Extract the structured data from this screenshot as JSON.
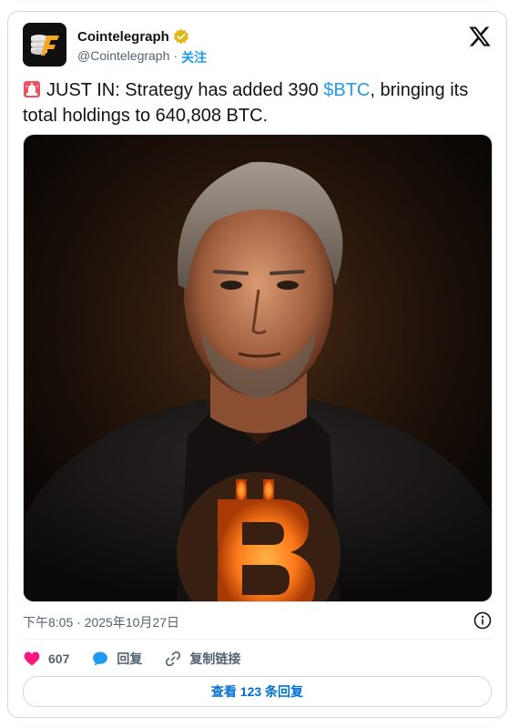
{
  "tweet": {
    "author_name": "Cointelegraph",
    "handle": "@Cointelegraph",
    "separator": "·",
    "follow_label": "关注",
    "text_prefix": "JUST IN: Strategy has added 390 ",
    "cashtag": "$BTC",
    "text_suffix": ", bringing its total holdings to 640,808 BTC.",
    "timestamp": "下午8:05 · 2025年10月27日"
  },
  "actions": {
    "like_count": "607",
    "reply_label": "回复",
    "copy_link_label": "复制链接"
  },
  "replies_button": "查看 123 条回复",
  "icons": {
    "verified": "verified-badge-icon",
    "x_logo": "x-logo-icon",
    "siren": "siren-emoji-icon",
    "info": "info-icon",
    "like": "heart-icon",
    "reply": "reply-bubble-icon",
    "link": "link-icon"
  },
  "colors": {
    "accent": "#1d9bf0",
    "like": "#f91880",
    "verified": "#e2b719",
    "muted": "#536471"
  }
}
